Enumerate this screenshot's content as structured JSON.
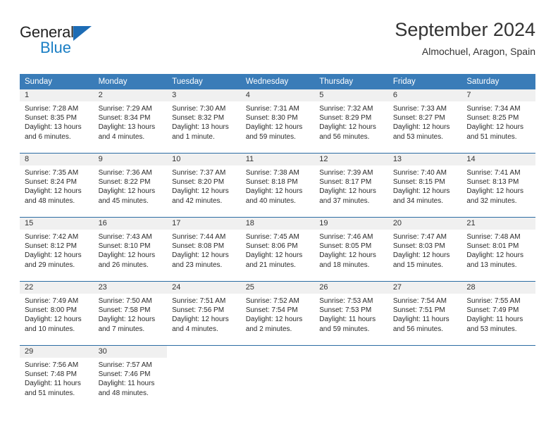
{
  "brand": {
    "name_part1": "General",
    "name_part2": "Blue",
    "logo_icon": "triangle-icon"
  },
  "header": {
    "title": "September 2024",
    "location": "Almochuel, Aragon, Spain"
  },
  "calendar": {
    "weekday_headers": [
      "Sunday",
      "Monday",
      "Tuesday",
      "Wednesday",
      "Thursday",
      "Friday",
      "Saturday"
    ],
    "accent_color": "#3a7cb8",
    "separator_color": "#2b6ca3",
    "day_band_color": "#f0f0f0",
    "weeks": [
      [
        {
          "day": "1",
          "sunrise": "Sunrise: 7:28 AM",
          "sunset": "Sunset: 8:35 PM",
          "daylight": "Daylight: 13 hours and 6 minutes."
        },
        {
          "day": "2",
          "sunrise": "Sunrise: 7:29 AM",
          "sunset": "Sunset: 8:34 PM",
          "daylight": "Daylight: 13 hours and 4 minutes."
        },
        {
          "day": "3",
          "sunrise": "Sunrise: 7:30 AM",
          "sunset": "Sunset: 8:32 PM",
          "daylight": "Daylight: 13 hours and 1 minute."
        },
        {
          "day": "4",
          "sunrise": "Sunrise: 7:31 AM",
          "sunset": "Sunset: 8:30 PM",
          "daylight": "Daylight: 12 hours and 59 minutes."
        },
        {
          "day": "5",
          "sunrise": "Sunrise: 7:32 AM",
          "sunset": "Sunset: 8:29 PM",
          "daylight": "Daylight: 12 hours and 56 minutes."
        },
        {
          "day": "6",
          "sunrise": "Sunrise: 7:33 AM",
          "sunset": "Sunset: 8:27 PM",
          "daylight": "Daylight: 12 hours and 53 minutes."
        },
        {
          "day": "7",
          "sunrise": "Sunrise: 7:34 AM",
          "sunset": "Sunset: 8:25 PM",
          "daylight": "Daylight: 12 hours and 51 minutes."
        }
      ],
      [
        {
          "day": "8",
          "sunrise": "Sunrise: 7:35 AM",
          "sunset": "Sunset: 8:24 PM",
          "daylight": "Daylight: 12 hours and 48 minutes."
        },
        {
          "day": "9",
          "sunrise": "Sunrise: 7:36 AM",
          "sunset": "Sunset: 8:22 PM",
          "daylight": "Daylight: 12 hours and 45 minutes."
        },
        {
          "day": "10",
          "sunrise": "Sunrise: 7:37 AM",
          "sunset": "Sunset: 8:20 PM",
          "daylight": "Daylight: 12 hours and 42 minutes."
        },
        {
          "day": "11",
          "sunrise": "Sunrise: 7:38 AM",
          "sunset": "Sunset: 8:18 PM",
          "daylight": "Daylight: 12 hours and 40 minutes."
        },
        {
          "day": "12",
          "sunrise": "Sunrise: 7:39 AM",
          "sunset": "Sunset: 8:17 PM",
          "daylight": "Daylight: 12 hours and 37 minutes."
        },
        {
          "day": "13",
          "sunrise": "Sunrise: 7:40 AM",
          "sunset": "Sunset: 8:15 PM",
          "daylight": "Daylight: 12 hours and 34 minutes."
        },
        {
          "day": "14",
          "sunrise": "Sunrise: 7:41 AM",
          "sunset": "Sunset: 8:13 PM",
          "daylight": "Daylight: 12 hours and 32 minutes."
        }
      ],
      [
        {
          "day": "15",
          "sunrise": "Sunrise: 7:42 AM",
          "sunset": "Sunset: 8:12 PM",
          "daylight": "Daylight: 12 hours and 29 minutes."
        },
        {
          "day": "16",
          "sunrise": "Sunrise: 7:43 AM",
          "sunset": "Sunset: 8:10 PM",
          "daylight": "Daylight: 12 hours and 26 minutes."
        },
        {
          "day": "17",
          "sunrise": "Sunrise: 7:44 AM",
          "sunset": "Sunset: 8:08 PM",
          "daylight": "Daylight: 12 hours and 23 minutes."
        },
        {
          "day": "18",
          "sunrise": "Sunrise: 7:45 AM",
          "sunset": "Sunset: 8:06 PM",
          "daylight": "Daylight: 12 hours and 21 minutes."
        },
        {
          "day": "19",
          "sunrise": "Sunrise: 7:46 AM",
          "sunset": "Sunset: 8:05 PM",
          "daylight": "Daylight: 12 hours and 18 minutes."
        },
        {
          "day": "20",
          "sunrise": "Sunrise: 7:47 AM",
          "sunset": "Sunset: 8:03 PM",
          "daylight": "Daylight: 12 hours and 15 minutes."
        },
        {
          "day": "21",
          "sunrise": "Sunrise: 7:48 AM",
          "sunset": "Sunset: 8:01 PM",
          "daylight": "Daylight: 12 hours and 13 minutes."
        }
      ],
      [
        {
          "day": "22",
          "sunrise": "Sunrise: 7:49 AM",
          "sunset": "Sunset: 8:00 PM",
          "daylight": "Daylight: 12 hours and 10 minutes."
        },
        {
          "day": "23",
          "sunrise": "Sunrise: 7:50 AM",
          "sunset": "Sunset: 7:58 PM",
          "daylight": "Daylight: 12 hours and 7 minutes."
        },
        {
          "day": "24",
          "sunrise": "Sunrise: 7:51 AM",
          "sunset": "Sunset: 7:56 PM",
          "daylight": "Daylight: 12 hours and 4 minutes."
        },
        {
          "day": "25",
          "sunrise": "Sunrise: 7:52 AM",
          "sunset": "Sunset: 7:54 PM",
          "daylight": "Daylight: 12 hours and 2 minutes."
        },
        {
          "day": "26",
          "sunrise": "Sunrise: 7:53 AM",
          "sunset": "Sunset: 7:53 PM",
          "daylight": "Daylight: 11 hours and 59 minutes."
        },
        {
          "day": "27",
          "sunrise": "Sunrise: 7:54 AM",
          "sunset": "Sunset: 7:51 PM",
          "daylight": "Daylight: 11 hours and 56 minutes."
        },
        {
          "day": "28",
          "sunrise": "Sunrise: 7:55 AM",
          "sunset": "Sunset: 7:49 PM",
          "daylight": "Daylight: 11 hours and 53 minutes."
        }
      ],
      [
        {
          "day": "29",
          "sunrise": "Sunrise: 7:56 AM",
          "sunset": "Sunset: 7:48 PM",
          "daylight": "Daylight: 11 hours and 51 minutes."
        },
        {
          "day": "30",
          "sunrise": "Sunrise: 7:57 AM",
          "sunset": "Sunset: 7:46 PM",
          "daylight": "Daylight: 11 hours and 48 minutes."
        },
        {
          "day": "",
          "sunrise": "",
          "sunset": "",
          "daylight": ""
        },
        {
          "day": "",
          "sunrise": "",
          "sunset": "",
          "daylight": ""
        },
        {
          "day": "",
          "sunrise": "",
          "sunset": "",
          "daylight": ""
        },
        {
          "day": "",
          "sunrise": "",
          "sunset": "",
          "daylight": ""
        },
        {
          "day": "",
          "sunrise": "",
          "sunset": "",
          "daylight": ""
        }
      ]
    ]
  }
}
